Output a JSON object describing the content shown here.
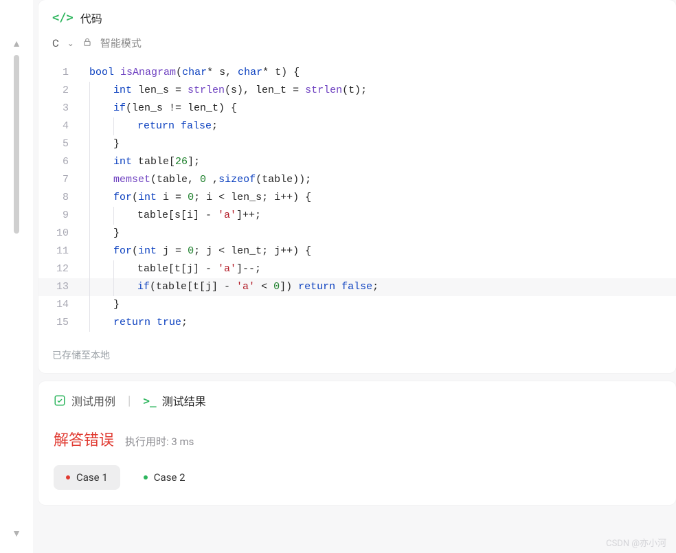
{
  "header": {
    "title": "代码",
    "language": "C",
    "modeLabel": "智能模式"
  },
  "editor": {
    "savedLabel": "已存储至本地",
    "lines": [
      {
        "n": 1,
        "indent": 0,
        "tokens": [
          [
            "kw",
            "bool"
          ],
          [
            "pln",
            " "
          ],
          [
            "fn",
            "isAnagram"
          ],
          [
            "pln",
            "("
          ],
          [
            "kw",
            "char"
          ],
          [
            "pln",
            "* s, "
          ],
          [
            "kw",
            "char"
          ],
          [
            "pln",
            "* t) {"
          ]
        ]
      },
      {
        "n": 2,
        "indent": 1,
        "tokens": [
          [
            "kw",
            "int"
          ],
          [
            "pln",
            " len_s = "
          ],
          [
            "fn",
            "strlen"
          ],
          [
            "pln",
            "(s), len_t = "
          ],
          [
            "fn",
            "strlen"
          ],
          [
            "pln",
            "(t);"
          ]
        ]
      },
      {
        "n": 3,
        "indent": 1,
        "tokens": [
          [
            "kw",
            "if"
          ],
          [
            "pln",
            "(len_s != len_t) {"
          ]
        ]
      },
      {
        "n": 4,
        "indent": 2,
        "tokens": [
          [
            "kw",
            "return"
          ],
          [
            "pln",
            " "
          ],
          [
            "lit",
            "false"
          ],
          [
            "pln",
            ";"
          ]
        ]
      },
      {
        "n": 5,
        "indent": 1,
        "tokens": [
          [
            "pln",
            "}"
          ]
        ]
      },
      {
        "n": 6,
        "indent": 1,
        "tokens": [
          [
            "kw",
            "int"
          ],
          [
            "pln",
            " table["
          ],
          [
            "num",
            "26"
          ],
          [
            "pln",
            "];"
          ]
        ]
      },
      {
        "n": 7,
        "indent": 1,
        "tokens": [
          [
            "fn",
            "memset"
          ],
          [
            "pln",
            "(table, "
          ],
          [
            "num",
            "0"
          ],
          [
            "pln",
            " ,"
          ],
          [
            "kw",
            "sizeof"
          ],
          [
            "pln",
            "(table));"
          ]
        ]
      },
      {
        "n": 8,
        "indent": 1,
        "tokens": [
          [
            "kw",
            "for"
          ],
          [
            "pln",
            "("
          ],
          [
            "kw",
            "int"
          ],
          [
            "pln",
            " i = "
          ],
          [
            "num",
            "0"
          ],
          [
            "pln",
            "; i < len_s; i++) {"
          ]
        ]
      },
      {
        "n": 9,
        "indent": 2,
        "tokens": [
          [
            "pln",
            "table[s[i] - "
          ],
          [
            "str",
            "'a'"
          ],
          [
            "pln",
            "]++;"
          ]
        ]
      },
      {
        "n": 10,
        "indent": 1,
        "tokens": [
          [
            "pln",
            "}"
          ]
        ]
      },
      {
        "n": 11,
        "indent": 1,
        "tokens": [
          [
            "kw",
            "for"
          ],
          [
            "pln",
            "("
          ],
          [
            "kw",
            "int"
          ],
          [
            "pln",
            " j = "
          ],
          [
            "num",
            "0"
          ],
          [
            "pln",
            "; j < len_t; j++) {"
          ]
        ]
      },
      {
        "n": 12,
        "indent": 2,
        "tokens": [
          [
            "pln",
            "table[t[j] - "
          ],
          [
            "str",
            "'a'"
          ],
          [
            "pln",
            "]--;"
          ]
        ]
      },
      {
        "n": 13,
        "indent": 2,
        "hl": true,
        "tokens": [
          [
            "kw",
            "if"
          ],
          [
            "pln",
            "(table[t[j] - "
          ],
          [
            "str",
            "'a'"
          ],
          [
            "pln",
            " < "
          ],
          [
            "num",
            "0"
          ],
          [
            "pln",
            "]) "
          ],
          [
            "kw",
            "return"
          ],
          [
            "pln",
            " "
          ],
          [
            "lit",
            "false"
          ],
          [
            "pln",
            ";"
          ]
        ]
      },
      {
        "n": 14,
        "indent": 1,
        "tokens": [
          [
            "pln",
            "}"
          ]
        ]
      },
      {
        "n": 15,
        "indent": 1,
        "tokens": [
          [
            "kw",
            "return"
          ],
          [
            "pln",
            " "
          ],
          [
            "lit",
            "true"
          ],
          [
            "pln",
            ";"
          ]
        ]
      }
    ]
  },
  "results": {
    "tabTestCases": "测试用例",
    "tabTestResults": "测试结果",
    "errorLabel": "解答错误",
    "runtimeLabel": "执行用时: 3 ms",
    "cases": [
      {
        "label": "Case 1",
        "status": "red",
        "active": true
      },
      {
        "label": "Case 2",
        "status": "green",
        "active": false
      }
    ]
  },
  "watermark": "CSDN @亦小河"
}
